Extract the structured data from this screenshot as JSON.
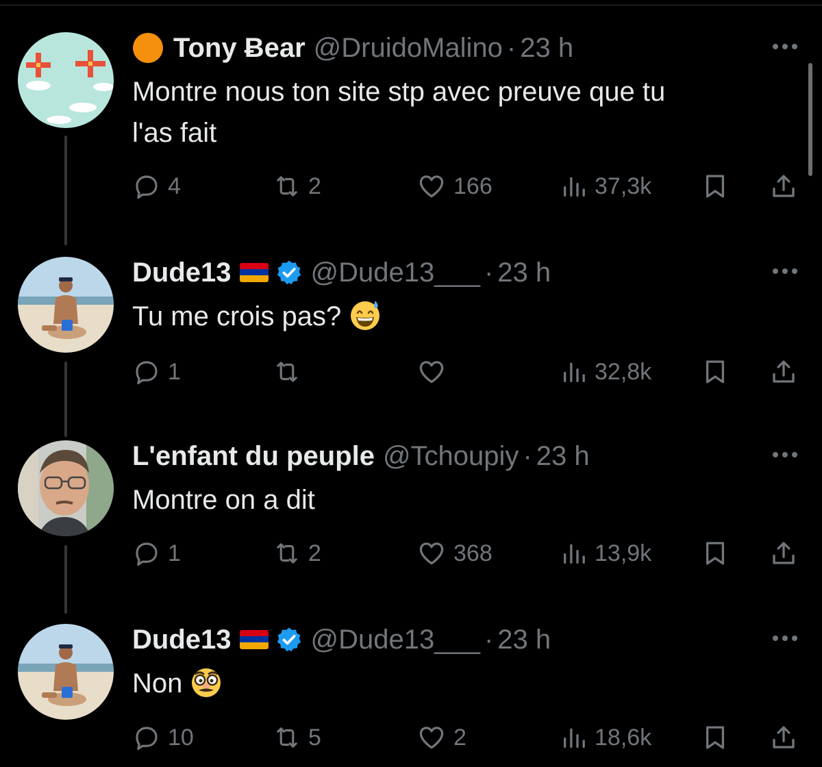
{
  "colors": {
    "background": "#000000",
    "text": "#e7e9ea",
    "muted": "#71767b",
    "verified": "#1d9bf0",
    "thread_line": "#333639"
  },
  "tweets": [
    {
      "prefix_emoji": "orange-circle",
      "display_name": "Tony Ƀear",
      "handle": "@DruidoMalino",
      "separator": "·",
      "time": "23 h",
      "text_lines": [
        "Montre nous ton site stp avec preuve que tu",
        "l'as fait"
      ],
      "text_emoji": null,
      "verified": false,
      "flag": null,
      "avatar": "clouds-crosses-avatar",
      "metrics": {
        "replies": "4",
        "retweets": "2",
        "likes": "166",
        "views": "37,3k"
      }
    },
    {
      "prefix_emoji": null,
      "display_name": "Dude13",
      "handle": "@Dude13___",
      "separator": "·",
      "time": "23 h",
      "text_lines": [
        "Tu me crois pas?"
      ],
      "text_emoji": "grinning-sweat-emoji",
      "verified": true,
      "flag": "armenia-flag",
      "avatar": "beach-person-avatar",
      "metrics": {
        "replies": "1",
        "retweets": "",
        "likes": "",
        "views": "32,8k"
      }
    },
    {
      "prefix_emoji": null,
      "display_name": "L'enfant du peuple",
      "handle": "@Tchoupiy",
      "separator": "·",
      "time": "23 h",
      "text_lines": [
        "Montre on a dit"
      ],
      "text_emoji": null,
      "verified": false,
      "flag": null,
      "avatar": "man-glasses-avatar",
      "metrics": {
        "replies": "1",
        "retweets": "2",
        "likes": "368",
        "views": "13,9k"
      }
    },
    {
      "prefix_emoji": null,
      "display_name": "Dude13",
      "handle": "@Dude13___",
      "separator": "·",
      "time": "23 h",
      "text_lines": [
        "Non"
      ],
      "text_emoji": "disguised-face-emoji",
      "verified": true,
      "flag": "armenia-flag",
      "avatar": "beach-person-avatar",
      "metrics": {
        "replies": "10",
        "retweets": "5",
        "likes": "2",
        "views": "18,6k"
      }
    }
  ]
}
